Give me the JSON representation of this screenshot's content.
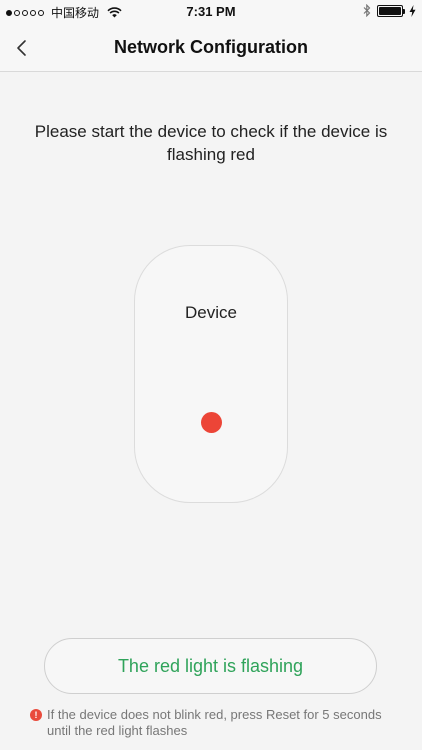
{
  "status_bar": {
    "carrier": "中国移动",
    "time": "7:31 PM"
  },
  "nav": {
    "title": "Network Configuration"
  },
  "instruction": "Please start the device to check if the device is flashing red",
  "device": {
    "label": "Device",
    "led_color": "#ec4537"
  },
  "confirm_button": {
    "label": "The red light is flashing",
    "color": "#2fa35a"
  },
  "hint": {
    "icon": "!",
    "text": "If the device does not blink red, press Reset for 5 seconds until the red light flashes"
  },
  "icons": {
    "back": "chevron-left-icon",
    "wifi": "wifi-icon",
    "bluetooth": "bluetooth-icon",
    "battery": "battery-icon",
    "charging": "charging-icon",
    "alert": "alert-icon"
  }
}
